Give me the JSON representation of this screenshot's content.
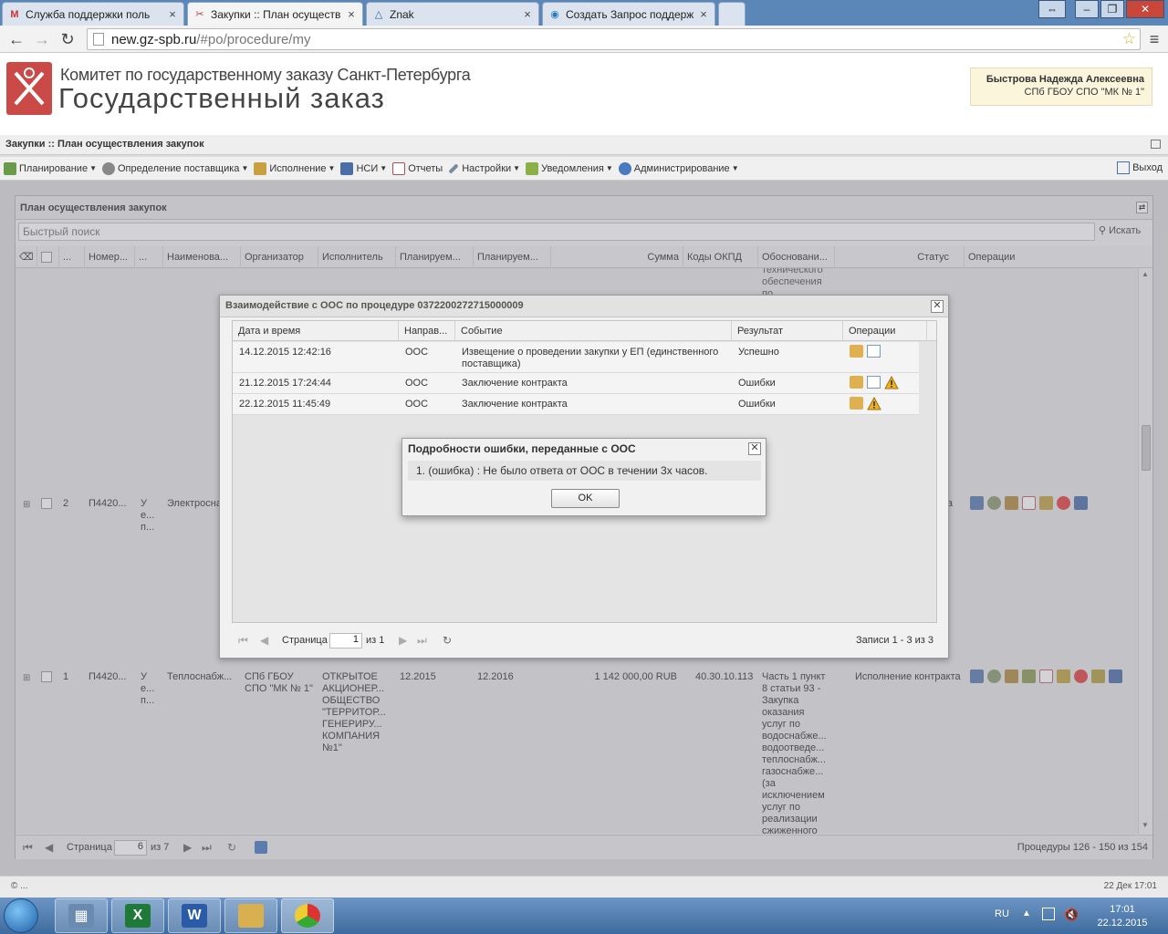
{
  "browser": {
    "tabs": [
      {
        "title": "Служба поддержки поль",
        "icon": "gmail-icon",
        "active": false
      },
      {
        "title": "Закупки :: План осуществ",
        "icon": "tools-icon",
        "active": true
      },
      {
        "title": "Znak",
        "icon": "znak-icon",
        "active": false
      },
      {
        "title": "Создать Запрос поддерж",
        "icon": "support-icon",
        "active": false
      }
    ],
    "address_host": "new.gz-spb.ru",
    "address_path": "/#po/procedure/my"
  },
  "site": {
    "org_line1": "Комитет по государственному заказу Санкт-Петербурга",
    "org_line2": "Государственный заказ",
    "user_name": "Быстрова Надежда Алексеевна",
    "user_org": "СПб ГБОУ СПО \"МК № 1\""
  },
  "page": {
    "title": "Закупки :: План осуществления закупок"
  },
  "menu": {
    "items": [
      {
        "label": "Планирование",
        "icon": "planning-icon",
        "color": "#6a9a4a",
        "dropdown": true
      },
      {
        "label": "Определение поставщика",
        "icon": "gears-icon",
        "color": "#777777",
        "dropdown": true
      },
      {
        "label": "Исполнение",
        "icon": "execution-icon",
        "color": "#c9a040",
        "dropdown": true
      },
      {
        "label": "НСИ",
        "icon": "book-icon",
        "color": "#4a6ea8",
        "dropdown": true
      },
      {
        "label": "Отчеты",
        "icon": "report-icon",
        "color": "#b05050",
        "dropdown": false
      },
      {
        "label": "Настройки",
        "icon": "wrench-icon",
        "color": "#7a8a9a",
        "dropdown": true
      },
      {
        "label": "Уведомления",
        "icon": "folder-icon",
        "color": "#8ab04a",
        "dropdown": true
      },
      {
        "label": "Администрирование",
        "icon": "user-icon",
        "color": "#4a7ac0",
        "dropdown": true
      }
    ],
    "logout": "Выход"
  },
  "panel": {
    "title": "План осуществления закупок",
    "search_placeholder": "Быстрый поиск",
    "search_button": "Искать",
    "columns": [
      "...",
      "Номер...",
      "...",
      "Наименова...",
      "Организатор",
      "Исполнитель",
      "Планируем...",
      "Планируем...",
      "Сумма",
      "Коды ОКПД",
      "Обосновани...",
      "Статус",
      "Операции"
    ]
  },
  "grid": {
    "row0_fragment": [
      "технического",
      "обеспечения",
      "по"
    ],
    "rows": [
      {
        "num": "2",
        "number": "П4420...",
        "type": [
          "У",
          "е...",
          "п..."
        ],
        "name": "Электросна",
        "status": "та"
      },
      {
        "num": "1",
        "number": "П4420...",
        "type": [
          "У",
          "е...",
          "п..."
        ],
        "name": "Теплоснабж...",
        "organizer": [
          "СПб ГБОУ",
          "СПО \"МК № 1\""
        ],
        "executor": [
          "ОТКРЫТОЕ",
          "АКЦИОНЕР...",
          "ОБЩЕСТВО",
          "\"ТЕРРИТОР...",
          "ГЕНЕРИРУ...",
          "КОМПАНИЯ",
          "№1\""
        ],
        "plan_start": "12.2015",
        "plan_end": "12.2016",
        "sum": "1 142 000,00 RUB",
        "okpd": "40.30.10.113",
        "basis": [
          "Часть 1 пункт",
          "8 статьи 93 -",
          "Закупка",
          "оказания",
          "услуг по",
          "водоснабже...",
          "водоотведе...",
          "теплоснабж...",
          "газоснабже...",
          "(за",
          "исключением",
          "услуг по",
          "реализации",
          "сжиженного"
        ],
        "status": "Исполнение контракта"
      }
    ],
    "pager": {
      "page_label": "Страница",
      "page": "6",
      "of": "из 7",
      "summary": "Процедуры 126 - 150 из 154"
    }
  },
  "oos_dialog": {
    "title": "Взаимодействие с ООС по процедуре 0372200272715000009",
    "columns": [
      "Дата и время",
      "Направ...",
      "Событие",
      "Результат",
      "Операции"
    ],
    "rows": [
      {
        "datetime": "14.12.2015 12:42:16",
        "direction": "ООС",
        "event": "Извещение о проведении закупки у ЕП (единственного поставщика)",
        "result": "Успешно",
        "ops": [
          "package-icon",
          "document-icon"
        ]
      },
      {
        "datetime": "21.12.2015 17:24:44",
        "direction": "ООС",
        "event": "Заключение контракта",
        "result": "Ошибки",
        "ops": [
          "package-icon",
          "document-icon",
          "warning-icon"
        ]
      },
      {
        "datetime": "22.12.2015 11:45:49",
        "direction": "ООС",
        "event": "Заключение контракта",
        "result": "Ошибки",
        "ops": [
          "package-icon",
          "warning-icon"
        ]
      }
    ],
    "pager": {
      "page_label": "Страница",
      "page": "1",
      "of": "из 1",
      "summary": "Записи 1 - 3 из 3"
    }
  },
  "error_dialog": {
    "title": "Подробности ошибки, переданные с ООС",
    "message": "1. (ошибка) : Не было ответа от ООС в течении 3х часов.",
    "ok": "OK"
  },
  "footer": {
    "left": "© ...",
    "right": "22 Дек 17:01"
  },
  "taskbar": {
    "lang": "RU",
    "time": "17:01",
    "date": "22.12.2015"
  }
}
